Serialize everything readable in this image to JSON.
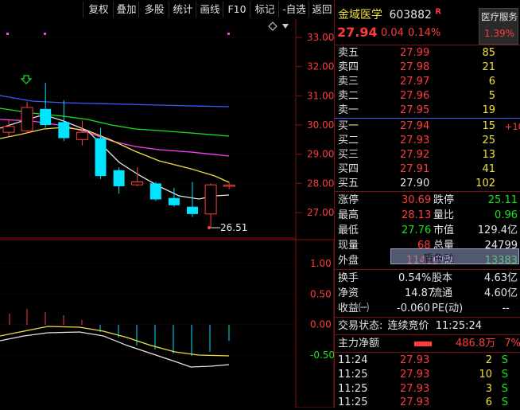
{
  "toolbar": {
    "buttons": [
      "复权",
      "叠加",
      "多股",
      "统计",
      "画线",
      "F10",
      "标记",
      "-自选",
      "返回"
    ]
  },
  "chart_data": {
    "type": "candlestick",
    "price_axis": {
      "ticks": [
        "33.00",
        "32.00",
        "31.00",
        "30.00",
        "29.00",
        "28.00",
        "27.00"
      ],
      "range": [
        26.4,
        33.3
      ]
    },
    "indicator_axis": {
      "ticks": [
        "1.00",
        "0.50",
        "0.00",
        "-0.50"
      ],
      "range": [
        -0.9,
        1.5
      ]
    },
    "low_annotation": "26.51",
    "candles": [
      {
        "o": 29.95,
        "h": 30.2,
        "l": 29.6,
        "c": 29.75,
        "dir": "up"
      },
      {
        "o": 29.8,
        "h": 30.8,
        "l": 29.7,
        "c": 30.6,
        "dir": "up"
      },
      {
        "o": 30.55,
        "h": 31.45,
        "l": 29.9,
        "c": 30.0,
        "dir": "down"
      },
      {
        "o": 30.1,
        "h": 30.85,
        "l": 29.45,
        "c": 29.55,
        "dir": "down"
      },
      {
        "o": 29.5,
        "h": 30.15,
        "l": 29.3,
        "c": 29.75,
        "dir": "up"
      },
      {
        "o": 29.55,
        "h": 29.9,
        "l": 28.15,
        "c": 28.25,
        "dir": "down"
      },
      {
        "o": 28.45,
        "h": 28.55,
        "l": 27.65,
        "c": 27.9,
        "dir": "down"
      },
      {
        "o": 27.95,
        "h": 28.55,
        "l": 27.9,
        "c": 28.05,
        "dir": "up"
      },
      {
        "o": 28.0,
        "h": 28.05,
        "l": 27.4,
        "c": 27.45,
        "dir": "down"
      },
      {
        "o": 27.5,
        "h": 27.85,
        "l": 27.2,
        "c": 27.25,
        "dir": "down"
      },
      {
        "o": 27.2,
        "h": 28.05,
        "l": 26.85,
        "c": 26.95,
        "dir": "down"
      },
      {
        "o": 26.95,
        "h": 28.0,
        "l": 26.51,
        "c": 27.95,
        "dir": "up"
      },
      {
        "o": 27.9,
        "h": 28.05,
        "l": 27.8,
        "c": 27.94,
        "dir": "up"
      }
    ],
    "colors": {
      "up": "#ff3c3c",
      "down": "#00e5ff",
      "ma_white": "#e6e6e6",
      "ma_yellow": "#f0e040",
      "ma_pink": "#ff40ff",
      "ma_green": "#19e31f",
      "ma_blue": "#3a5cff"
    }
  },
  "header": {
    "stock_name": "金域医学",
    "code": "603882",
    "badge": "R",
    "price": "27.94",
    "change": "0.04",
    "change_pct": "0.14%",
    "sector_name": "医疗服务",
    "sector_pct": "1.39%"
  },
  "order_book": {
    "asks": [
      {
        "label": "卖五",
        "price": "27.99",
        "vol": "85"
      },
      {
        "label": "卖四",
        "price": "27.98",
        "vol": "21"
      },
      {
        "label": "卖三",
        "price": "27.97",
        "vol": "6"
      },
      {
        "label": "卖二",
        "price": "27.96",
        "vol": "5"
      },
      {
        "label": "卖一",
        "price": "27.95",
        "vol": "19"
      }
    ],
    "bids": [
      {
        "label": "买一",
        "price": "27.94",
        "vol": "15",
        "extra": "+10"
      },
      {
        "label": "买二",
        "price": "27.93",
        "vol": "25",
        "extra": ""
      },
      {
        "label": "买三",
        "price": "27.92",
        "vol": "13",
        "extra": ""
      },
      {
        "label": "买四",
        "price": "27.91",
        "vol": "41",
        "extra": ""
      },
      {
        "label": "买五",
        "price": "27.90",
        "vol": "102",
        "extra": ""
      }
    ]
  },
  "stats": {
    "limit_up_label": "涨停",
    "limit_up": "30.69",
    "limit_down_label": "跌停",
    "limit_down": "25.11",
    "high_label": "最高",
    "high": "28.13",
    "vol_ratio_label": "量比",
    "vol_ratio": "0.96",
    "low_label": "最低",
    "low": "27.76",
    "mkt_cap_label": "市值",
    "mkt_cap": "129.4亿",
    "cur_vol_label": "现量",
    "cur_vol": "68",
    "total_vol_label": "总量",
    "total_vol": "24799",
    "outer_label": "外盘",
    "outer": "11416",
    "inner_label": "内盘",
    "inner": "13383",
    "overlay_text": "盾鱼动",
    "turnover_label": "换手",
    "turnover": "0.54%",
    "equity_label": "股本",
    "equity": "4.63亿",
    "nav_label": "净资",
    "nav": "14.87",
    "float_label": "流通",
    "float": "4.60亿",
    "eps_label": "收益㈠",
    "eps": "-0.060",
    "pe_label": "PE(动)",
    "pe": "--"
  },
  "status": {
    "label": "交易状态:",
    "value": "连续竞价",
    "time": "11:25:24"
  },
  "main_flow": {
    "label": "主力净额",
    "value": "486.8万",
    "pct": "7%"
  },
  "ticks": [
    {
      "time": "11:24",
      "price": "27.93",
      "vol": "2",
      "side": "S"
    },
    {
      "time": "11:25",
      "price": "27.93",
      "vol": "10",
      "side": "S"
    },
    {
      "time": "11:25",
      "price": "27.93",
      "vol": "3",
      "side": "S"
    },
    {
      "time": "11:25",
      "price": "27.93",
      "vol": "6",
      "side": "S"
    }
  ]
}
